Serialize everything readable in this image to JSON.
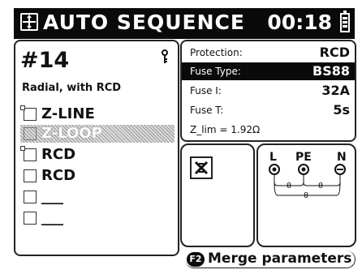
{
  "header": {
    "title": "AUTO SEQUENCE",
    "time": "00:18"
  },
  "left_panel": {
    "sequence_number": "#14",
    "sequence_name": "Radial, with RCD",
    "items": [
      {
        "label": "Z-LINE",
        "has_indicator": true,
        "selected": false
      },
      {
        "label": "Z-LOOP",
        "has_indicator": false,
        "selected": true
      },
      {
        "label": "RCD",
        "has_indicator": true,
        "selected": false
      },
      {
        "label": "RCD",
        "has_indicator": false,
        "selected": false
      },
      {
        "label": "___",
        "has_indicator": false,
        "selected": false
      },
      {
        "label": "___",
        "has_indicator": false,
        "selected": false
      }
    ]
  },
  "parameters": [
    {
      "key": "Protection:",
      "value": "RCD",
      "highlighted": false
    },
    {
      "key": "Fuse Type:",
      "value": "BS88",
      "highlighted": true
    },
    {
      "key": "Fuse I:",
      "value": "32A",
      "highlighted": false
    },
    {
      "key": "Fuse T:",
      "value": "5s",
      "highlighted": false
    }
  ],
  "z_lim": "Z_lim = 1.92Ω",
  "connection": {
    "terminals": [
      "L",
      "PE",
      "N"
    ],
    "values": [
      "0",
      "0",
      "0"
    ]
  },
  "footer": {
    "key": "F2",
    "label": "Merge parameters"
  },
  "icons": [
    "sequence-icon",
    "battery-icon",
    "key-icon",
    "no-connection-icon",
    "connection-diagram-icon"
  ]
}
